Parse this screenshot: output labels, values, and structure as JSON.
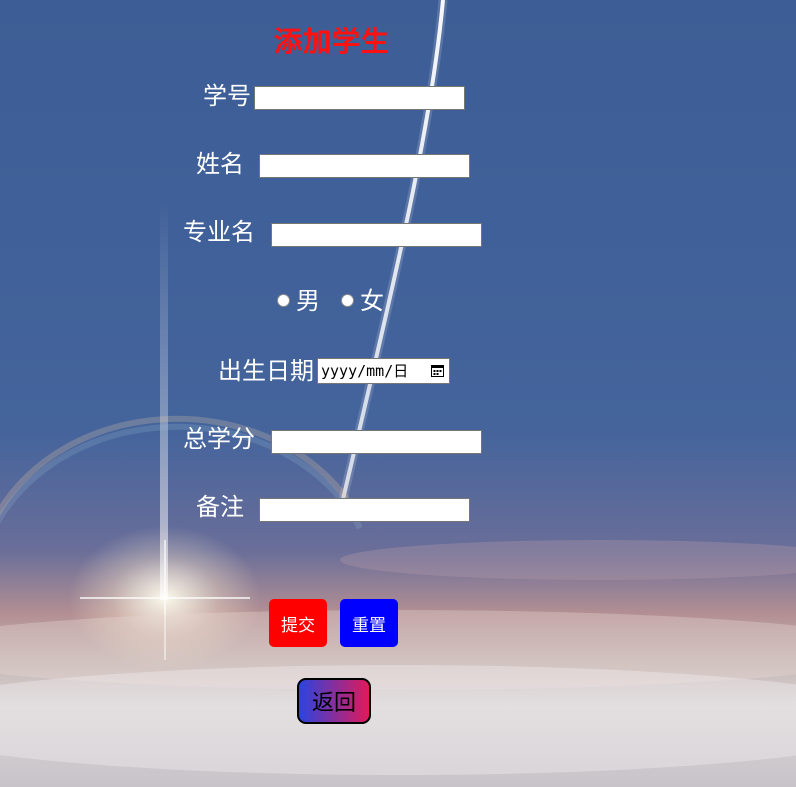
{
  "page": {
    "title": "添加学生"
  },
  "form": {
    "student_id_label": "学号",
    "name_label": "姓名",
    "major_label": "专业名",
    "gender_male_label": "男",
    "gender_female_label": "女",
    "birthdate_label": "出生日期",
    "birthdate_placeholder": "yyyy/mm/日",
    "credits_label": "总学分",
    "remarks_label": "备注"
  },
  "buttons": {
    "submit": "提交",
    "reset": "重置",
    "back": "返回"
  },
  "colors": {
    "title": "#ff1111",
    "submit_bg": "#ff0000",
    "reset_bg": "#0000ff"
  }
}
